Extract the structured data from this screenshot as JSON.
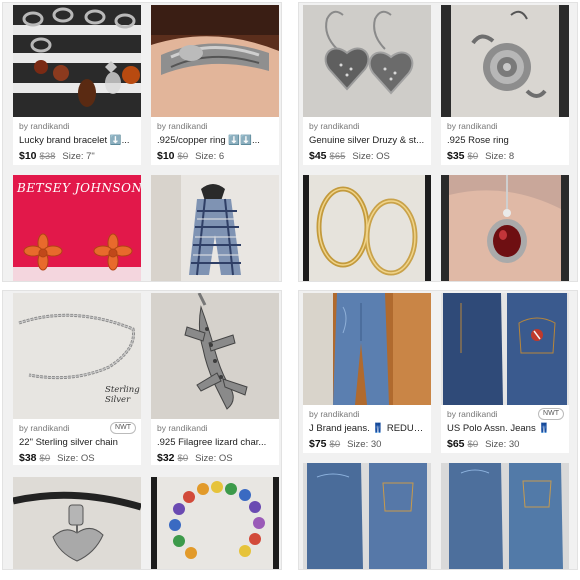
{
  "listings": [
    {
      "seller": "by randikandi",
      "title": "Lucky brand bracelet ⬇️...",
      "price": "$10",
      "orig": "$38",
      "size": "Size: 7\""
    },
    {
      "seller": "by randikandi",
      "title": ".925/copper ring ⬇️⬇️...",
      "price": "$10",
      "orig": "$0",
      "size": "Size: 6"
    },
    {
      "seller": "by randikandi",
      "title": "Genuine silver Druzy & st...",
      "price": "$45",
      "orig": "$65",
      "size": "Size: OS"
    },
    {
      "seller": "by randikandi",
      "title": ".925 Rose ring",
      "price": "$35",
      "orig": "$0",
      "size": "Size: 8"
    },
    {
      "seller": "by randikandi",
      "title": "22\" Sterling silver chain",
      "price": "$38",
      "orig": "$0",
      "size": "Size: OS",
      "badge": "NWT"
    },
    {
      "seller": "by randikandi",
      "title": ".925 Filagree lizard char...",
      "price": "$32",
      "orig": "$0",
      "size": "Size: OS"
    },
    {
      "seller": "by randikandi",
      "title": "J Brand jeans. 👖 REDUC...",
      "price": "$75",
      "orig": "$0",
      "size": "Size: 30"
    },
    {
      "seller": "by randikandi",
      "title": "US Polo Assn. Jeans 👖",
      "price": "$65",
      "orig": "$0",
      "size": "Size: 30",
      "badge": "NWT"
    }
  ],
  "photo_text": {
    "betsey": "BETSEY JOHNSON",
    "sterling": "Sterling Silver"
  }
}
